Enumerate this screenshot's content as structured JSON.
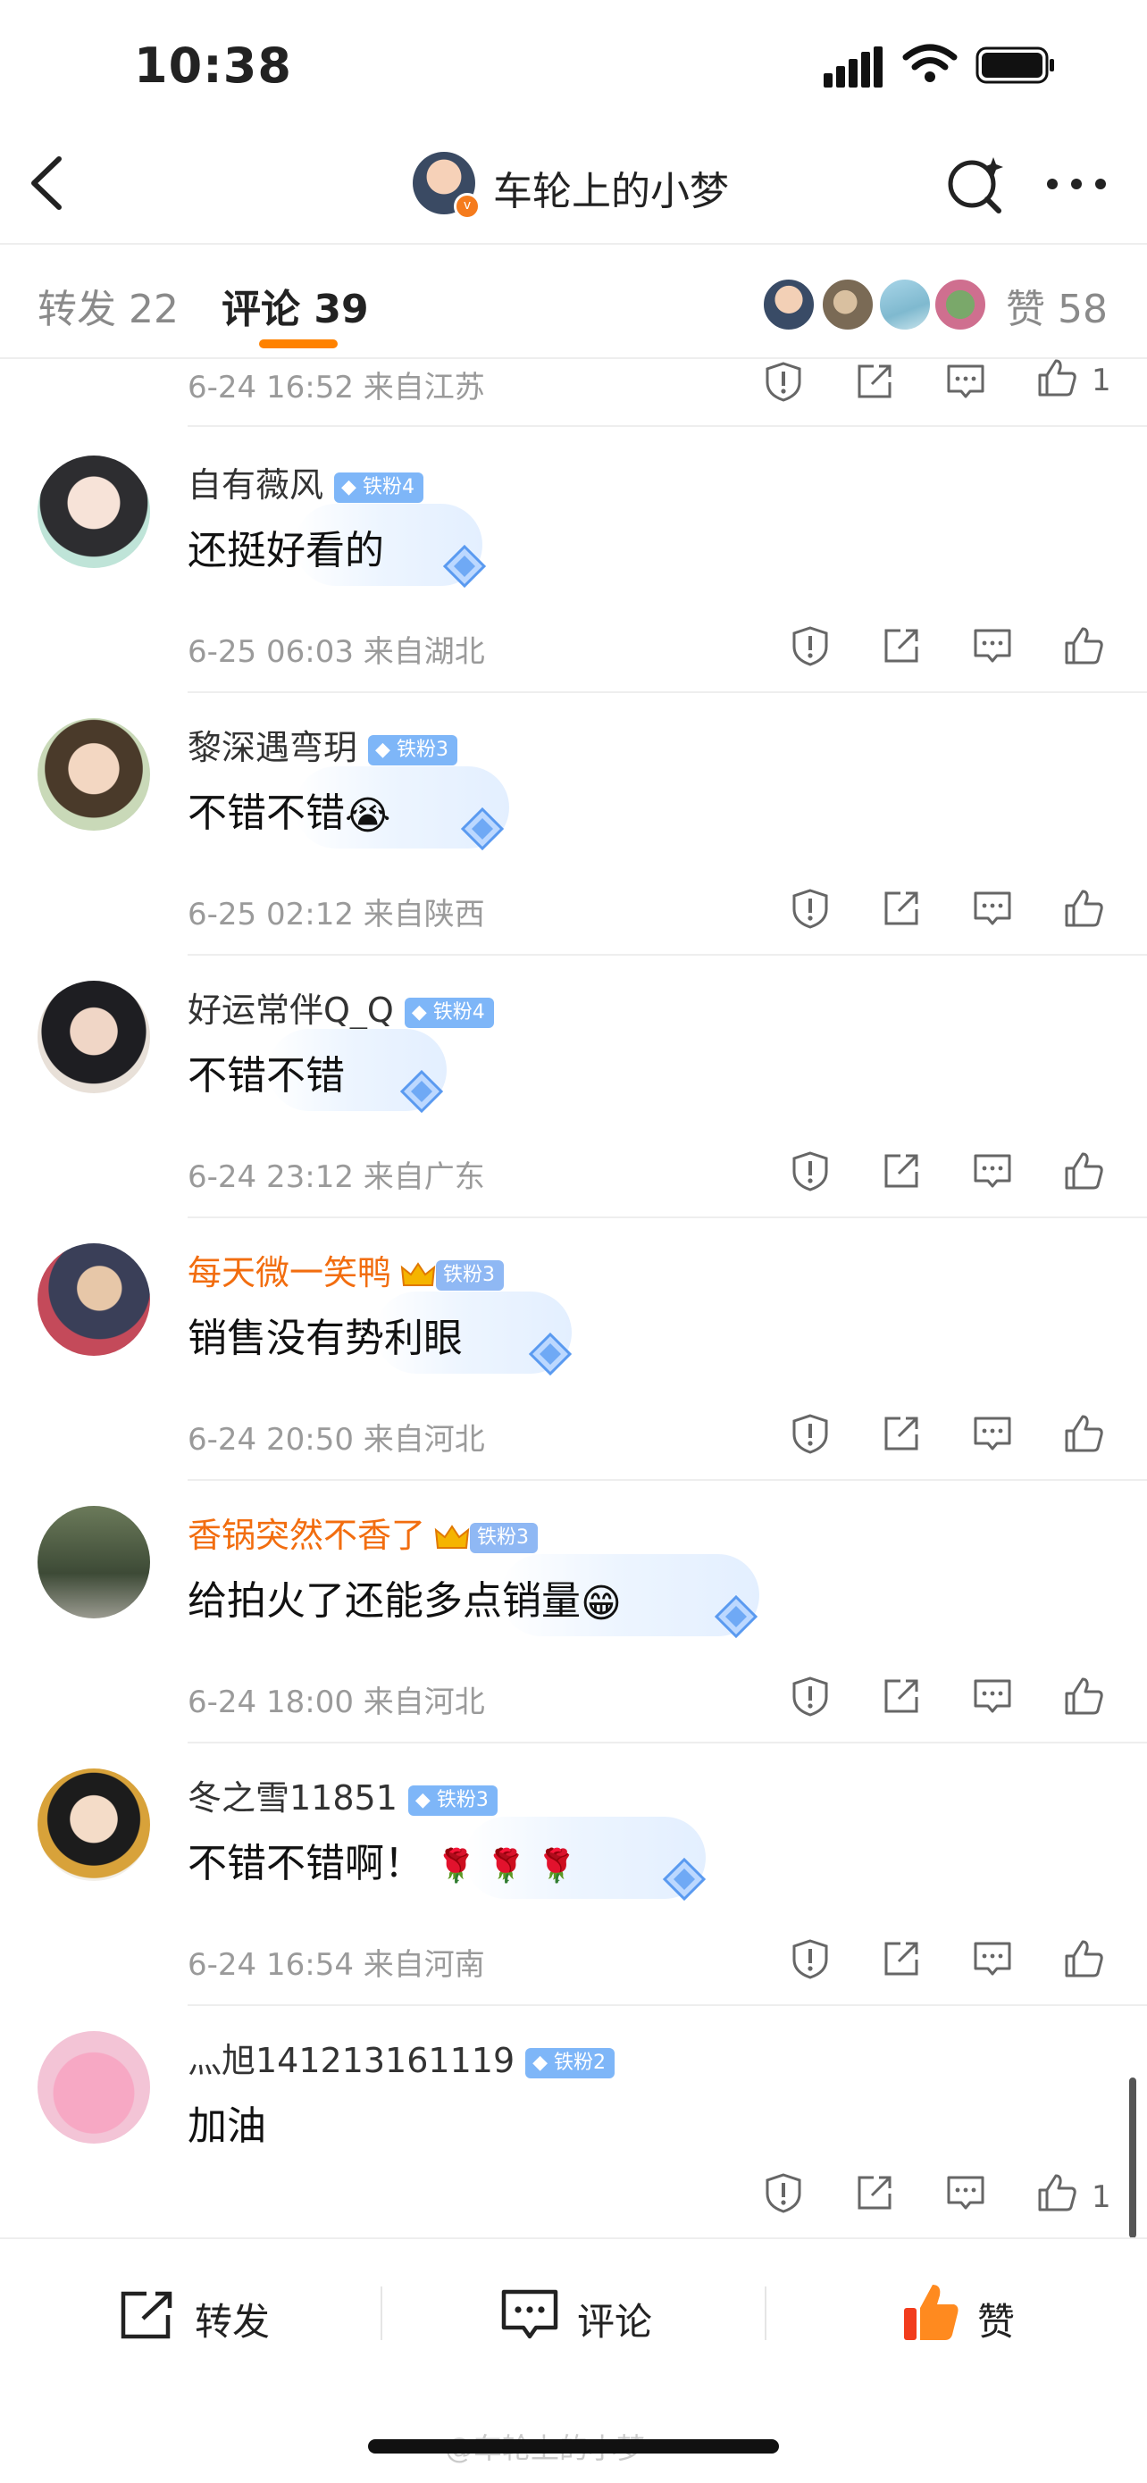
{
  "status_bar": {
    "time": "10:38"
  },
  "nav": {
    "title": "车轮上的小梦"
  },
  "tabs": {
    "repost_label": "转发",
    "repost_count": "22",
    "comment_label": "评论",
    "comment_count": "39",
    "like_label": "赞",
    "like_count": "58"
  },
  "partial_top": {
    "meta": "6-24 16:52  来自江苏",
    "like_count": "1"
  },
  "comments": [
    {
      "name": "自有薇风",
      "badge": "铁粉4",
      "text": "还挺好看的",
      "meta": "6-25 06:03  来自湖北"
    },
    {
      "name": "黎深遇弯玥",
      "badge": "铁粉3",
      "text": "不错不错",
      "emoji": "😭",
      "meta": "6-25 02:12  来自陕西"
    },
    {
      "name": "好运常伴Q_Q",
      "badge": "铁粉4",
      "text": "不错不错",
      "meta": "6-24 23:12  来自广东"
    },
    {
      "name": "每天微一笑鸭",
      "badge": "铁粉3",
      "text": "销售没有势利眼",
      "meta": "6-24 20:50  来自河北",
      "name_color": "#f26d0f"
    },
    {
      "name": "香锅突然不香了",
      "badge": "铁粉3",
      "text": "给拍火了还能多点销量",
      "emoji": "😁",
      "meta": "6-24 18:00  来自河北",
      "name_color": "#f26d0f"
    },
    {
      "name": "冬之雪11851",
      "badge": "铁粉3",
      "text": "不错不错啊！",
      "emoji": "🌹 🌹 🌹",
      "meta": "6-24 16:54  来自河南"
    },
    {
      "name": "灬旭141213161119",
      "badge": "铁粉2",
      "text": "加油",
      "like_count": "1"
    }
  ],
  "bottom_bar": {
    "repost": "转发",
    "comment": "评论",
    "like": "赞"
  },
  "watermark": "@车轮上的小梦",
  "colors": {
    "accent": "#ff8200",
    "fan_badge": "#7eb6f8",
    "vip_name": "#f26d0f"
  }
}
